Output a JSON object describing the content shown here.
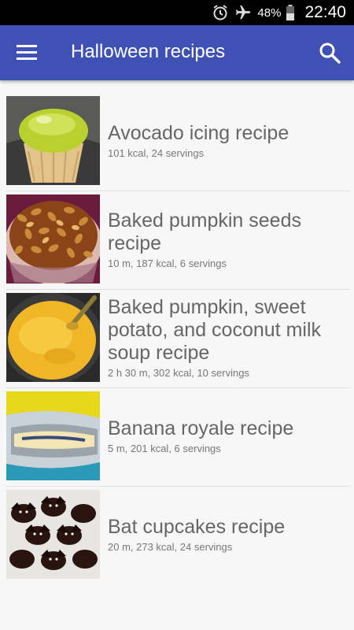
{
  "status_bar": {
    "icons": [
      "alarm-icon",
      "airplane-mode-icon",
      "battery-icon"
    ],
    "battery": "48%",
    "time": "22:40"
  },
  "app_bar": {
    "title": "Halloween recipes",
    "menu_icon": "hamburger-menu-icon",
    "search_icon": "search-icon",
    "color": "#3f51b5"
  },
  "recipes": [
    {
      "name": "Avocado icing recipe",
      "meta": "101 kcal, 24 servings",
      "image": "cupcake-with-green-icing"
    },
    {
      "name": "Baked pumpkin seeds recipe",
      "meta": "10 m, 187 kcal, 6 servings",
      "image": "bowl-of-roasted-pumpkin-seeds"
    },
    {
      "name": "Baked pumpkin, sweet potato, and coconut milk soup recipe",
      "meta": "2 h 30 m, 302 kcal, 10 servings",
      "image": "pot-of-orange-soup"
    },
    {
      "name": "Banana royale  recipe",
      "meta": "5 m, 201 kcal, 6 servings",
      "image": "banana-in-foil"
    },
    {
      "name": "Bat cupcakes recipe",
      "meta": "20 m, 273 kcal, 24 servings",
      "image": "chocolate-bat-cupcakes"
    }
  ]
}
